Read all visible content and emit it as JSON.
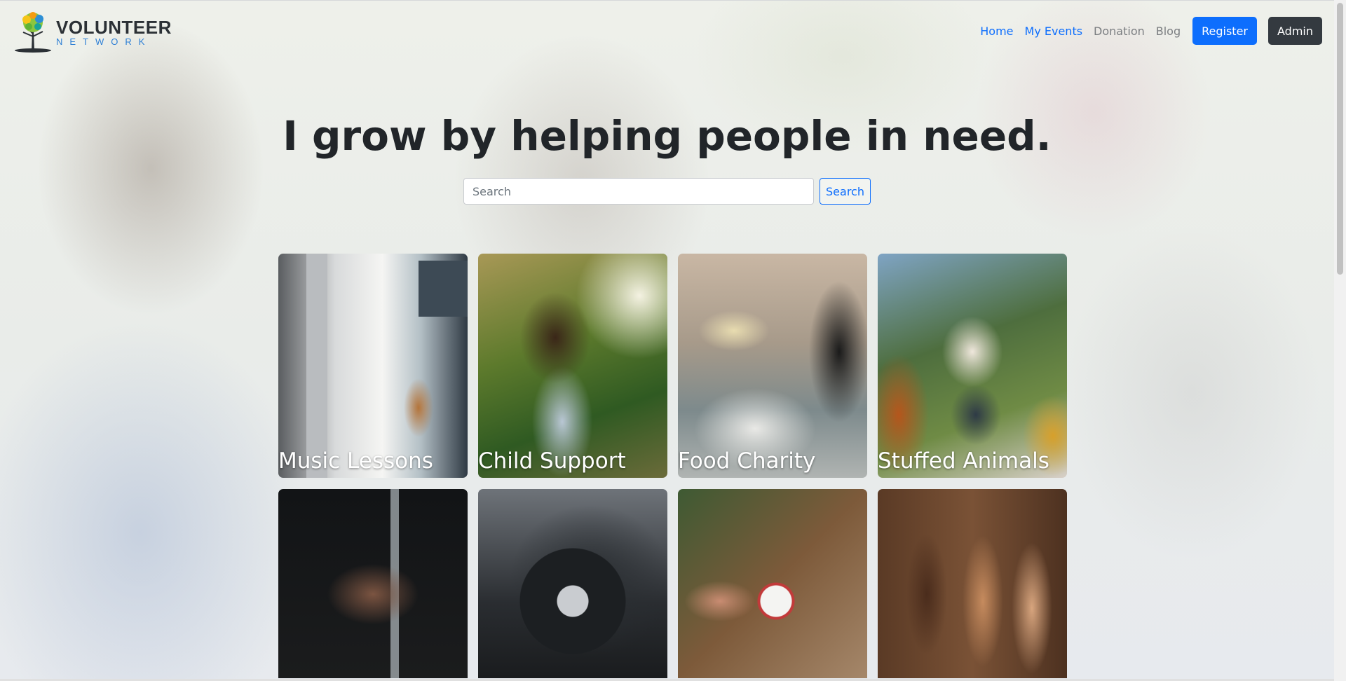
{
  "brand": {
    "line1": "VOLUNTEER",
    "line2": "NETWORK"
  },
  "nav": {
    "links": [
      {
        "label": "Home",
        "state": "active"
      },
      {
        "label": "My Events",
        "state": "active"
      },
      {
        "label": "Donation",
        "state": "muted"
      },
      {
        "label": "Blog",
        "state": "muted"
      }
    ],
    "register_label": "Register",
    "admin_label": "Admin"
  },
  "hero": {
    "headline": "I grow by helping people in need.",
    "search_placeholder": "Search",
    "search_button": "Search"
  },
  "categories": [
    {
      "label": "Music Lessons"
    },
    {
      "label": "Child Support"
    },
    {
      "label": "Food Charity"
    },
    {
      "label": "Stuffed Animals"
    },
    {
      "label": ""
    },
    {
      "label": ""
    },
    {
      "label": ""
    },
    {
      "label": ""
    }
  ],
  "colors": {
    "primary": "#0d6efd",
    "dark": "#343a40",
    "brand_blue": "#2d7fd5"
  }
}
